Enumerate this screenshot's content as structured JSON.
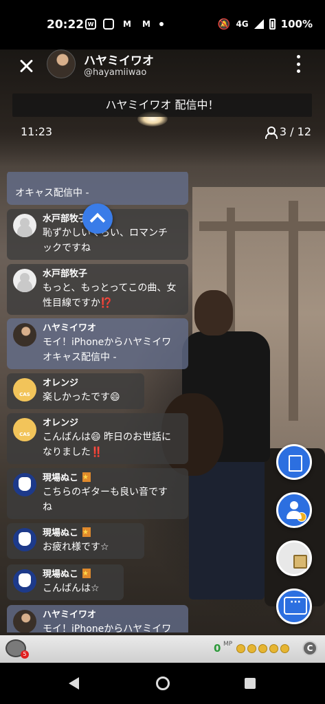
{
  "status_bar": {
    "time": "20:22",
    "network": "4G",
    "battery": "100%",
    "icons": [
      "wn-icon",
      "instagram-icon",
      "gmail-icon",
      "gmail-icon",
      "dot-icon",
      "mute-icon",
      "signal-icon",
      "battery-icon"
    ]
  },
  "header": {
    "host_name": "ハヤミイワオ",
    "host_id": "@hayamiiwao",
    "banner": "ハヤミイワオ 配信中！",
    "elapsed": "11:23",
    "viewers": "3 / 12"
  },
  "comments": [
    {
      "name": "",
      "text": "オキャス配信中 -",
      "avatar": "host"
    },
    {
      "name": "水戸部牧子",
      "text": "恥ずかしいくらい、ロマンチ\nックですね",
      "avatar": "gray"
    },
    {
      "name": "水戸部牧子",
      "text": "もっと、もっとってこの曲、女\n性目線ですか⁉️",
      "avatar": "gray"
    },
    {
      "name": "ハヤミイワオ",
      "text": "モイ！iPhoneからハヤミイワ\nオキャス配信中 -",
      "avatar": "host"
    },
    {
      "name": "オレンジ",
      "text": "楽しかったです😄",
      "avatar": "cast"
    },
    {
      "name": "オレンジ",
      "text": "こんばんは😄 昨日のお世話に\nなりました‼️",
      "avatar": "cast"
    },
    {
      "name": "現場ぬこ",
      "text": "こちらのギターも良い音です\nね",
      "avatar": "cat"
    },
    {
      "name": "現場ぬこ",
      "text": "お疲れ様です☆",
      "avatar": "cat"
    },
    {
      "name": "現場ぬこ",
      "text": "こんばんは☆",
      "avatar": "cat"
    },
    {
      "name": "ハヤミイワオ",
      "text": "モイ！iPhoneからハヤミイワ",
      "avatar": "host"
    }
  ],
  "avatar_label_cast": "CAS",
  "bottom_bar": {
    "mp_value": "0",
    "mp_label": "MP",
    "coin_badge": "5",
    "token_label": "C"
  },
  "colors": {
    "accent": "#2c6fe0",
    "comment_bg": "#3c3c3c",
    "host_comment_bg": "#646e8c"
  }
}
